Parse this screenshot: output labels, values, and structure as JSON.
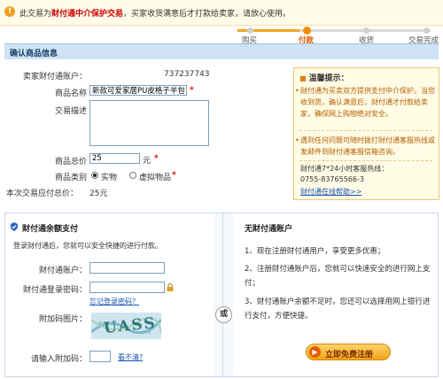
{
  "notice": {
    "prefix": "此交易为",
    "highlight": "财付通中介保护交易",
    "suffix": "，买家收货满意后才打款给卖家，请放心使用。"
  },
  "steps": [
    "购买",
    "付款",
    "收货",
    "交易完成"
  ],
  "active_step": 1,
  "section_title": "确认商品信息",
  "form": {
    "seller_label": "卖家财付通账户：",
    "seller_value": "737237743",
    "name_label": "商品名称",
    "name_value": "新款可爱家居PU皮格子半包棉",
    "desc_label": "交易描述",
    "price_label": "商品总价",
    "price_value": "25",
    "price_unit": "元",
    "type_label": "商品类别",
    "type_options": [
      "实物",
      "虚拟物品"
    ],
    "total_label": "本次交易应付总价：",
    "total_value": "25元",
    "required_mark": "*"
  },
  "tips": {
    "title": "温馨提示：",
    "p1": "财付通为买卖双方提供支付中介保护。当您收到货，确认满意后，财付通才付款给卖家，确保网上购物绝对安全。",
    "p2": "遇到任何问题可随时拨打财付通客服热线或发邮件到财付通客服信箱咨询。",
    "p3": "财付通7*24小时客服热线：",
    "phone": "0755-83765566-3",
    "help_link": "财付通在线帮助>>"
  },
  "balance_pay": {
    "title": "财付通余额支付",
    "desc": "登录财付通后，您就可以安全快捷的进行付款。",
    "account_label": "财付通账户：",
    "password_label": "财付通登录密码：",
    "forgot_link": "忘记登录密码？",
    "captcha_label": "附加码图片：",
    "captcha_text": "UASS",
    "input_captcha_label": "请输入附加码：",
    "unclear_link": "看不清?"
  },
  "or_label": "或",
  "no_account": {
    "title": "无财付通账户",
    "items": [
      "1、现在注册财付通用户，享受更多优惠；",
      "2、注册财付通账户后，您就可以快速安全的进行网上支付；",
      "3、财付通账户余额不足时，您还可以选择用网上银行进行支付，方便快捷。"
    ],
    "register_button": "立即免费注册"
  },
  "colors": {
    "accent_orange": "#f08c00",
    "header_blue": "#cfe3f5",
    "tip_text": "#b25e00",
    "link_blue": "#1a55b5"
  }
}
